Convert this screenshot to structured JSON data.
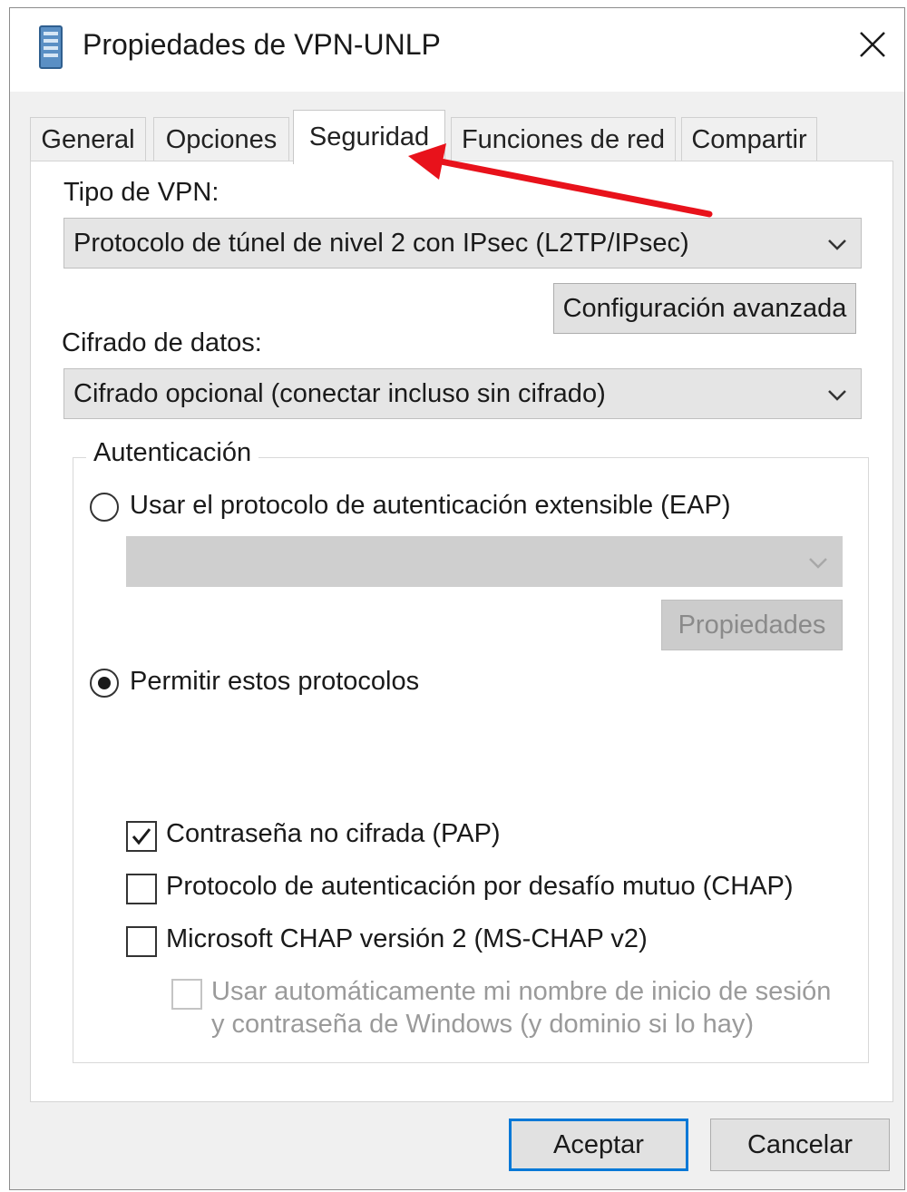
{
  "window": {
    "title": "Propiedades de VPN-UNLP",
    "close_icon": "close-icon"
  },
  "tabs": [
    {
      "label": "General"
    },
    {
      "label": "Opciones"
    },
    {
      "label": "Seguridad",
      "active": true
    },
    {
      "label": "Funciones de red"
    },
    {
      "label": "Compartir"
    }
  ],
  "security": {
    "vpn_type_label": "Tipo de VPN:",
    "vpn_type_value": "Protocolo de túnel de nivel 2 con IPsec (L2TP/IPsec)",
    "advanced_button": "Configuración avanzada",
    "encryption_label": "Cifrado de datos:",
    "encryption_value": "Cifrado opcional (conectar incluso sin cifrado)",
    "auth": {
      "group_title": "Autenticación",
      "eap_radio_label": "Usar el protocolo de autenticación extensible (EAP)",
      "eap_selected": false,
      "eap_select_value": "",
      "eap_properties_button": "Propiedades",
      "allow_radio_label": "Permitir estos protocolos",
      "allow_selected": true,
      "protocols": [
        {
          "label": "Contraseña no cifrada (PAP)",
          "checked": true,
          "enabled": true
        },
        {
          "label": "Protocolo de autenticación por desafío mutuo (CHAP)",
          "checked": false,
          "enabled": true
        },
        {
          "label": "Microsoft CHAP versión 2 (MS-CHAP v2)",
          "checked": false,
          "enabled": true
        }
      ],
      "windows_logon": {
        "line1": "Usar automáticamente mi nombre de inicio de sesión",
        "line2": "y contraseña de Windows (y dominio si lo hay)",
        "checked": false,
        "enabled": false
      }
    }
  },
  "footer": {
    "ok_button": "Aceptar",
    "cancel_button": "Cancelar"
  },
  "colors": {
    "annotation_arrow": "#e8121b",
    "focus_border": "#0078d7"
  }
}
